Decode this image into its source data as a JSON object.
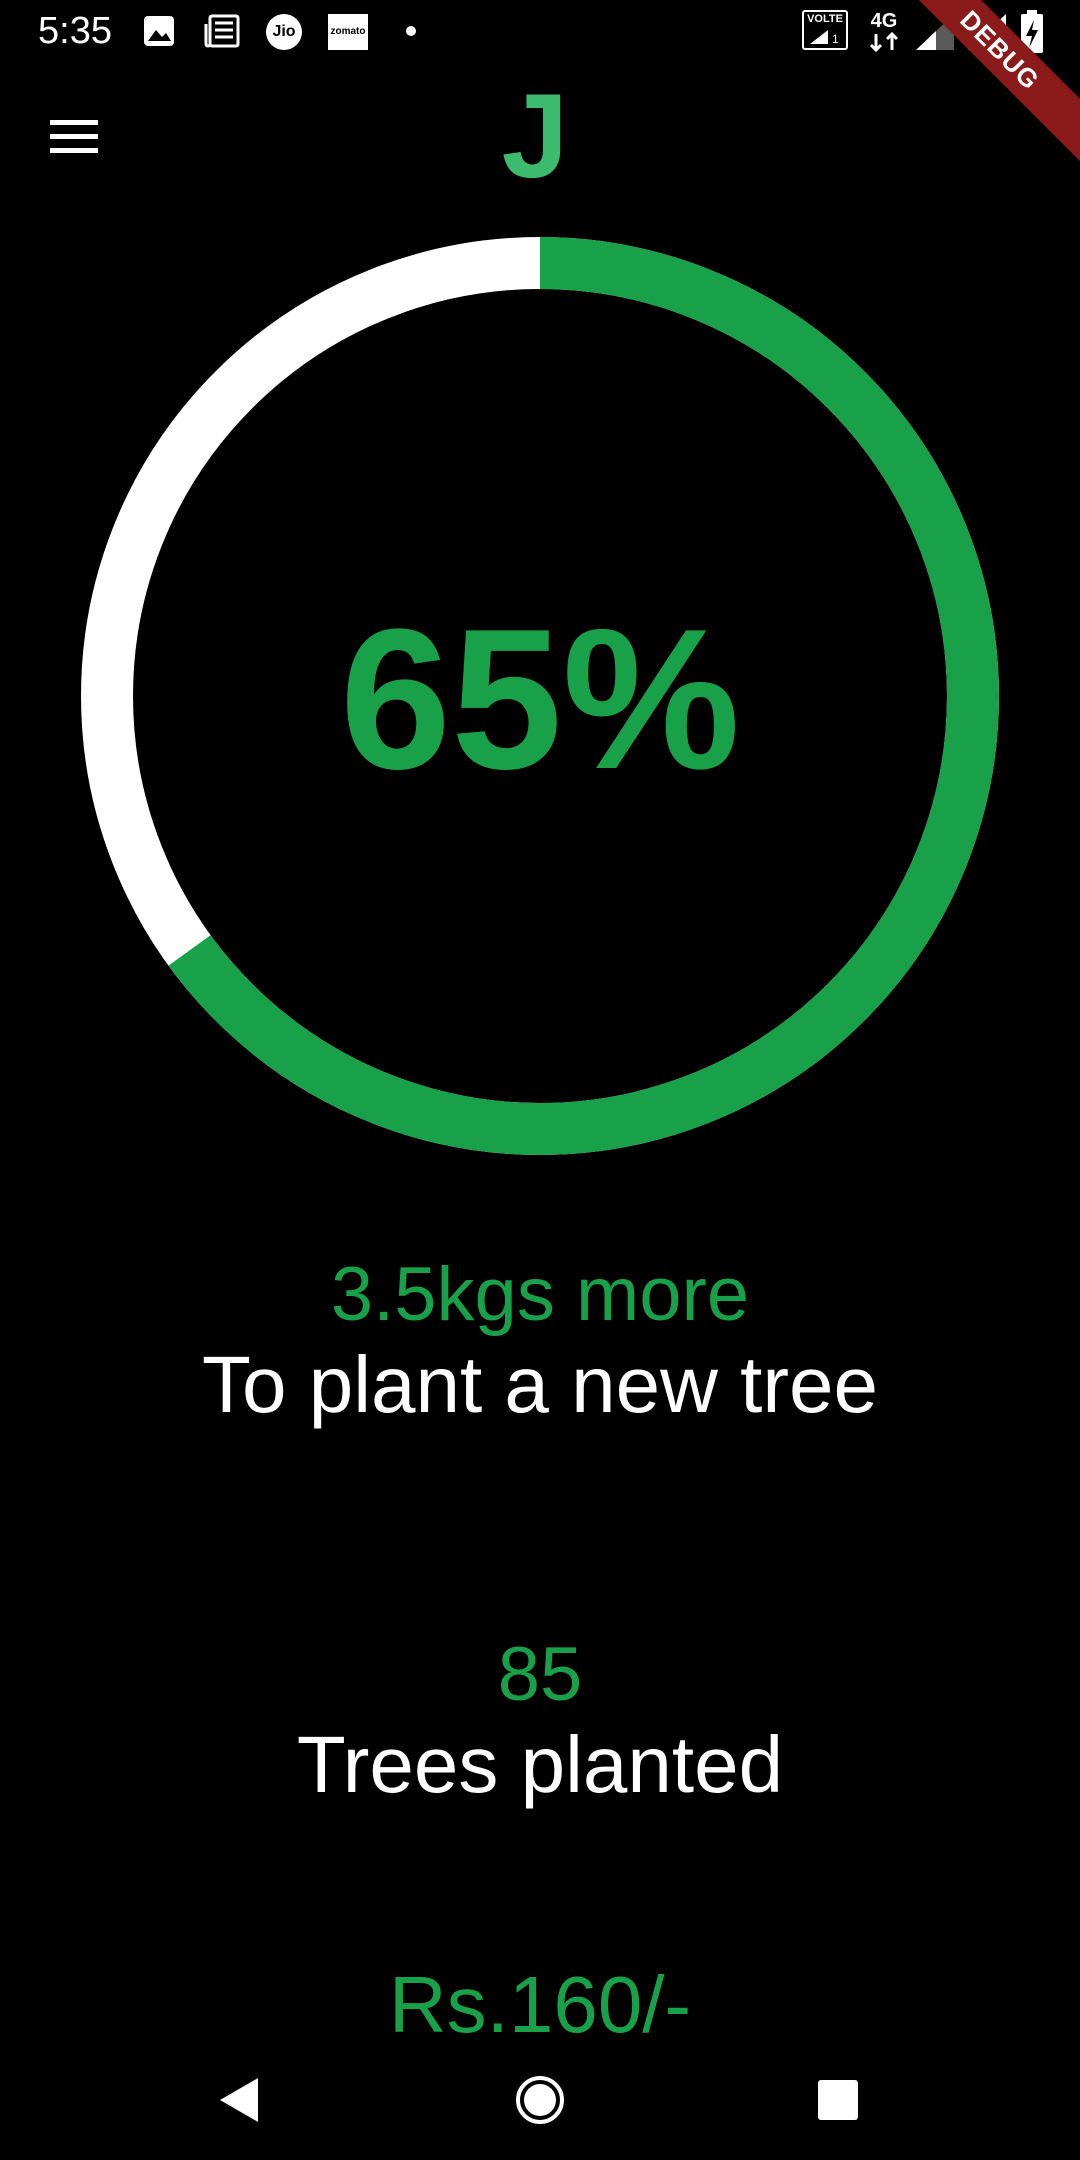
{
  "status_bar": {
    "time": "5:35",
    "notification_icons": [
      "gallery-icon",
      "news-icon",
      "jio-icon",
      "zomato-icon",
      "dot-icon"
    ],
    "jio_label": "Jio",
    "zomato_label": "zomato",
    "volte_label": "VOLTE",
    "network_label": "4G",
    "debug_label": "DEBUG"
  },
  "app_bar": {
    "logo_letter": "J"
  },
  "progress": {
    "percent_label": "65%",
    "fraction": 0.65,
    "progress_color": "#18a148",
    "track_color": "#ffffff"
  },
  "stats": {
    "kgs_value": "3.5kgs more",
    "kgs_label": "To plant a new tree",
    "trees_value": "85",
    "trees_label": "Trees planted",
    "money_value": "Rs.160/-"
  },
  "colors": {
    "accent": "#18a148",
    "logo": "#3cba6e",
    "background": "#000000",
    "text": "#ffffff"
  }
}
